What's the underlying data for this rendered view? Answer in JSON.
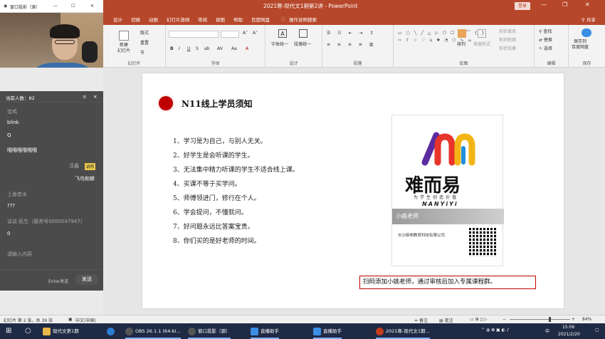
{
  "window": {
    "title": "2021寒-现代文1期第2讲 - PowerPoint",
    "login_label": "登录",
    "min": "—",
    "restore": "❐",
    "close": "✕"
  },
  "tabs": [
    "设计",
    "切换",
    "动画",
    "幻灯片放映",
    "审阅",
    "视图",
    "帮助",
    "百度网盘"
  ],
  "tell_me": "操作说明搜索",
  "share_label": "共享",
  "ribbon": {
    "slides_group": {
      "new_slide": "新建\n幻灯片",
      "layout": "版式",
      "reset": "重置",
      "section": "节",
      "label": "幻灯片"
    },
    "font_group": {
      "label": "字体",
      "buttons": [
        "B",
        "I",
        "U",
        "S",
        "ab",
        "AV",
        "Aa",
        "A"
      ]
    },
    "design_group": {
      "font_unify": "字体统一",
      "para_unify": "段落统一",
      "label": "设计"
    },
    "para_group": {
      "label": "段落"
    },
    "draw_group": {
      "arrange": "排列",
      "quick_styles": "快速样式",
      "fill": "形状填充",
      "outline": "形状轮廓",
      "effects": "形状效果",
      "label": "绘图"
    },
    "edit_group": {
      "find": "查找",
      "replace": "替换",
      "select": "选择",
      "label": "编辑"
    },
    "save_group": {
      "save": "保存到\n百度网盘",
      "label": "保存"
    }
  },
  "webcam_window": {
    "title": "窗口投影（源）",
    "min": "—",
    "max": "☐",
    "close": "✕"
  },
  "chat": {
    "online_count": "当前人数：82",
    "menu": "≡",
    "close": "✕",
    "messages": [
      {
        "text": "宝鸡",
        "dim": true
      },
      {
        "text": "blink",
        "dim": false
      },
      {
        "text": "Q",
        "dim": false
      },
      {
        "text": "哦哦哦哦哦哦",
        "dim": false
      },
      {
        "text": "淳鑫",
        "dim": true
      },
      {
        "text": "飞鸟和蝉",
        "dim": false
      },
      {
        "text": "上善若水",
        "dim": true
      },
      {
        "text": "???",
        "dim": false
      },
      {
        "text": "谈谈·民生（服务号0000047947）",
        "dim": true
      },
      {
        "text": "0",
        "dim": false
      },
      {
        "text": "请输入内容",
        "dim": true
      }
    ],
    "badge1": "讲师",
    "enter_hint": "Enter发送",
    "send_label": "发送"
  },
  "slide": {
    "title": "N11线上学员须知",
    "items": [
      "1、学习是为自己，与别人无关。",
      "2、好学生是会听课的学生。",
      "3、无法集中精力听课的学生不适合线上课。",
      "4、买课不等于买学问。",
      "5、师傅领进门，修行在个人。",
      "6、学会提问，不懂就问。",
      "7、好问题永远比答案宝贵。",
      "8、你们买的是好老师的时间。"
    ],
    "logo_text": "难而易",
    "logo_slogan": "为学生创造价值",
    "logo_en": "NANYiYi",
    "teacher": "小姚老师",
    "company": "长沙新朔教育科技有限公司",
    "cta": "扫码添加小姚老师，通过审核后加入专属课程群。"
  },
  "status": {
    "slide_info": "幻灯片 第 2 张，共 39 张",
    "lang": "中文(中国)",
    "notes": "备注",
    "comments": "批注",
    "zoom": "84%"
  },
  "taskbar": {
    "items": [
      {
        "label": "现代文第1期",
        "color": "#e8b64a"
      },
      {
        "label": "",
        "color": "#2b7cd3"
      },
      {
        "label": "OBS 26.1.1 (64-bi...",
        "color": "#555555"
      },
      {
        "label": "窗口投影（源）",
        "color": "#555555"
      },
      {
        "label": "直播助手",
        "color": "#3a8ee6"
      },
      {
        "label": "直播助手",
        "color": "#3a8ee6"
      },
      {
        "label": "2021寒-现代文1期...",
        "color": "#c43e1c"
      }
    ],
    "lang_tray": "中",
    "time": "15:06",
    "date": "2021/2/20"
  }
}
